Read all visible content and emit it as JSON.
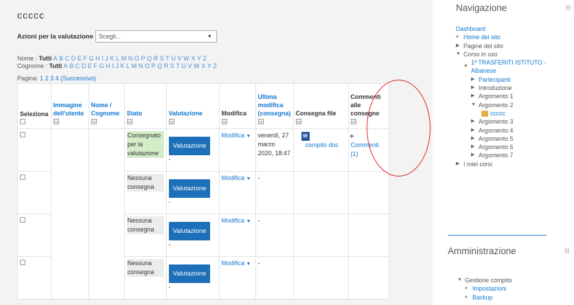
{
  "page": {
    "title": "ccccc",
    "actions_label": "Azioni per la valutazione",
    "actions_select": "Scegli..."
  },
  "initials": {
    "first_label": "Nome :",
    "last_label": "Cognome :",
    "all": "Tutti",
    "letters": [
      "A",
      "B",
      "C",
      "D",
      "E",
      "F",
      "G",
      "H",
      "I",
      "J",
      "K",
      "L",
      "M",
      "N",
      "O",
      "P",
      "Q",
      "R",
      "S",
      "T",
      "U",
      "V",
      "W",
      "X",
      "Y",
      "Z"
    ]
  },
  "pagination": {
    "label": "Pagina:",
    "pages": [
      "1",
      "2",
      "3",
      "4"
    ],
    "next": "(Successivo)"
  },
  "table": {
    "headers": {
      "select": "Seleziona",
      "picture": "Immagine dell'utente",
      "name": "Nome / Cognome",
      "status": "Stato",
      "grade": "Valutazione",
      "edit": "Modifica",
      "modified": "Ultima modifica (consegna)",
      "files": "Consegna file",
      "comments": "Commenti alle consegne"
    },
    "grade_button": "Valutazione",
    "edit_menu": "Modifica",
    "rows": [
      {
        "status": "Consegnato per la valutazione",
        "grade_extra": "-",
        "modified": "venerdì, 27 marzo 2020, 18:47",
        "file_name": "compito doc",
        "comments": "Commenti (1)",
        "submitted": true
      },
      {
        "status": "Nessuna consegna",
        "grade_extra": "-",
        "modified": "-",
        "file_name": "",
        "comments": "",
        "submitted": false
      },
      {
        "status": "Nessuna consegna",
        "grade_extra": "-",
        "modified": "-",
        "file_name": "",
        "comments": "",
        "submitted": false
      },
      {
        "status": "Nessuna consegna",
        "grade_extra": "-",
        "modified": "-",
        "file_name": "",
        "comments": "",
        "submitted": false
      }
    ]
  },
  "navigation": {
    "title": "Navigazione",
    "dashboard": "Dashboard",
    "home": "Home del sito",
    "site_pages": "Pagine del sito",
    "current_course": "Corso in uso",
    "course_name_1": "1ª TRASFERITI ISTITUTO -",
    "course_name_2": "Albanese",
    "participants": "Partecipanti",
    "intro": "Introduzione",
    "topics": [
      "Argomento 1",
      "Argomento 2",
      "Argomento 3",
      "Argomento 4",
      "Argomento 5",
      "Argomento 6",
      "Argomento 7"
    ],
    "activity": "ccccc",
    "my_courses": "I miei corsi"
  },
  "admin": {
    "title": "Amministrazione",
    "assignment_admin": "Gestione compito",
    "settings": "Impostazioni",
    "backup": "Backup"
  },
  "icons": {
    "collapse": "collapse-icon",
    "word_file": "word-file-icon",
    "folder": "folder-icon"
  },
  "colors": {
    "link": "#1177d1",
    "button": "#1c6fb8",
    "submitted_bg": "#d4edc9",
    "annotation": "#e02020"
  }
}
